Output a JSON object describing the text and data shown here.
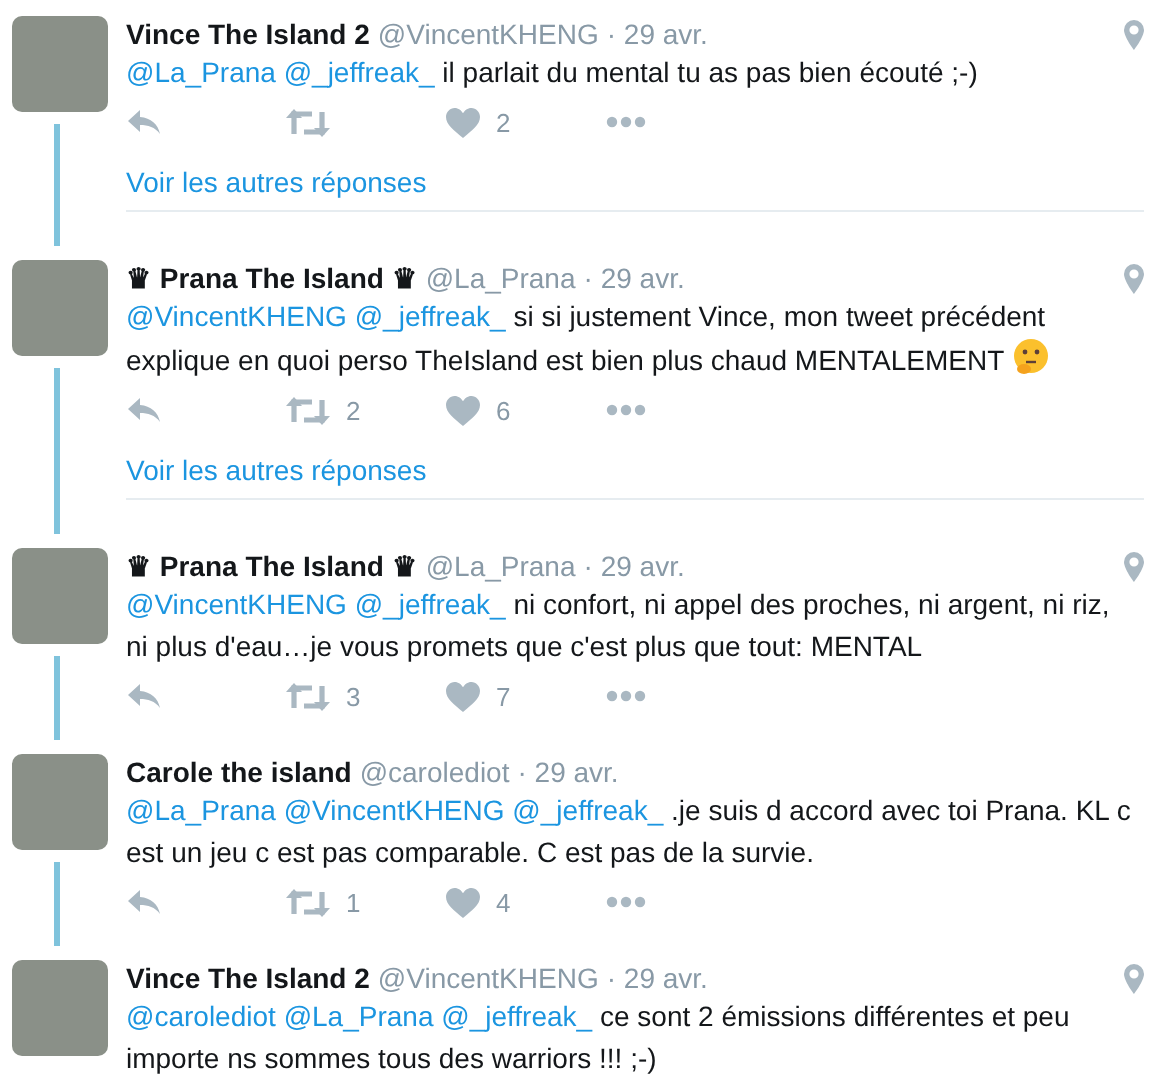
{
  "tweets": [
    {
      "name": "Vince The Island 2",
      "handle": "@VincentKHENG",
      "date": "· 29 avr.",
      "mentions": [
        "@La_Prana",
        "@_jeffreak_"
      ],
      "text": "il parlait du mental tu as pas bien écouté ;-)",
      "likes": "2",
      "more_replies": "Voir les autres réponses",
      "location": true,
      "thread_line": true
    },
    {
      "name": "♛ Prana The Island ♛",
      "handle": "@La_Prana",
      "date": "· 29 avr.",
      "mentions": [
        "@VincentKHENG",
        "@_jeffreak_"
      ],
      "text": "si si justement Vince, mon tweet précédent explique en quoi perso TheIsland est bien plus chaud MENTALEMENT",
      "thinking_emoji": true,
      "retweets": "2",
      "likes": "6",
      "more_replies": "Voir les autres réponses",
      "location": true,
      "thread_line": true
    },
    {
      "name": "♛ Prana The Island ♛",
      "handle": "@La_Prana",
      "date": "· 29 avr.",
      "mentions": [
        "@VincentKHENG",
        "@_jeffreak_"
      ],
      "text": "ni confort, ni appel des proches, ni argent, ni riz, ni plus d'eau…je vous promets que c'est plus que tout: MENTAL",
      "retweets": "3",
      "likes": "7",
      "location": true,
      "thread_line": true
    },
    {
      "name": "Carole the island",
      "handle": "@carolediot",
      "date": "· 29 avr.",
      "mentions": [
        "@La_Prana",
        "@VincentKHENG",
        "@_jeffreak_"
      ],
      "text": ".je suis d accord avec toi Prana. KL c est un jeu c est pas comparable. C est pas de la survie.",
      "retweets": "1",
      "likes": "4",
      "location": false,
      "thread_line": true
    },
    {
      "name": "Vince The Island 2",
      "handle": "@VincentKHENG",
      "date": "· 29 avr.",
      "mentions": [
        "@carolediot",
        "@La_Prana",
        "@_jeffreak_"
      ],
      "text": "ce sont 2 émissions différentes et peu importe ns sommes tous des warriors !!! ;-)",
      "location": true,
      "thread_line": false
    }
  ]
}
